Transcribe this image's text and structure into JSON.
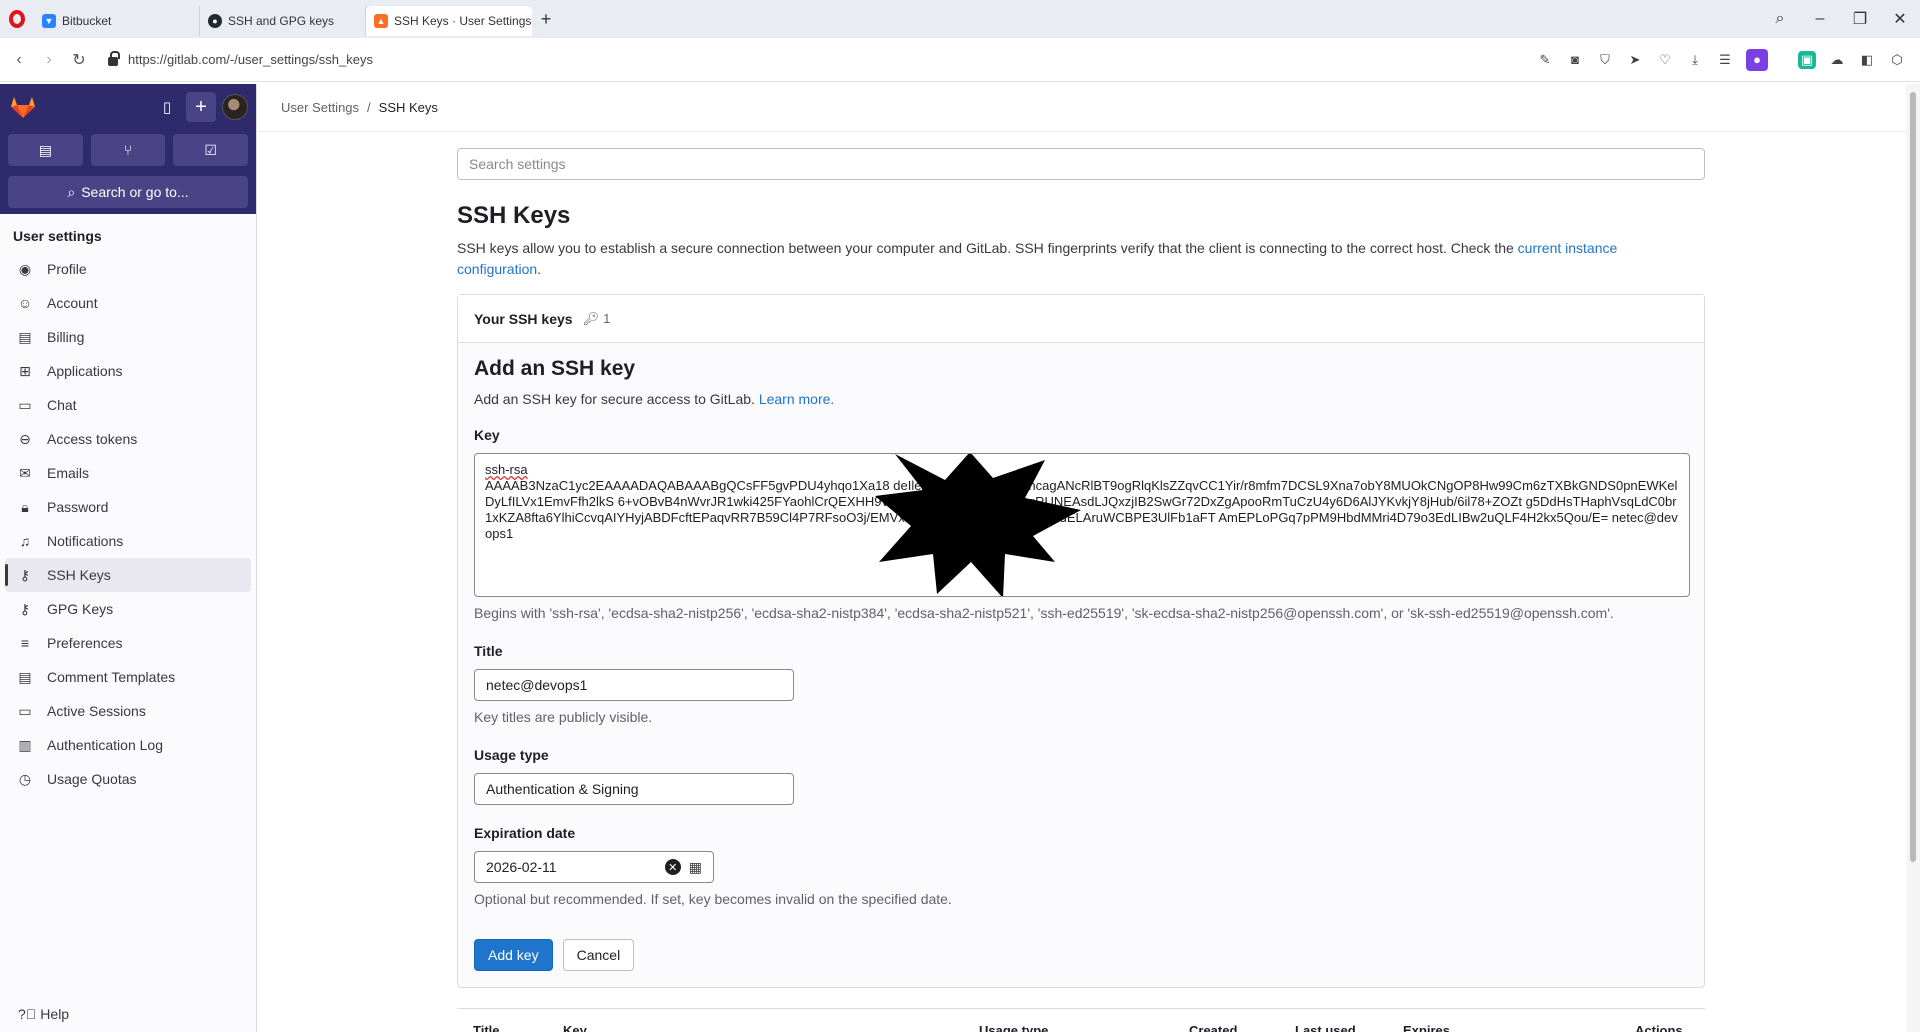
{
  "browser": {
    "tabs": [
      {
        "title": "Bitbucket",
        "color": "#2684ff"
      },
      {
        "title": "SSH and GPG keys",
        "color": "#24292f"
      },
      {
        "title": "SSH Keys · User Settings · G",
        "color": "#fc6d26"
      }
    ],
    "url": "https://gitlab.com/-/user_settings/ssh_keys"
  },
  "sidebar": {
    "search_label": "Search or go to...",
    "section_title": "User settings",
    "items": [
      {
        "label": "Profile",
        "icon": "profile-icon"
      },
      {
        "label": "Account",
        "icon": "account-icon"
      },
      {
        "label": "Billing",
        "icon": "billing-icon"
      },
      {
        "label": "Applications",
        "icon": "applications-icon"
      },
      {
        "label": "Chat",
        "icon": "chat-icon"
      },
      {
        "label": "Access tokens",
        "icon": "token-icon"
      },
      {
        "label": "Emails",
        "icon": "mail-icon"
      },
      {
        "label": "Password",
        "icon": "lock-icon"
      },
      {
        "label": "Notifications",
        "icon": "bell-icon"
      },
      {
        "label": "SSH Keys",
        "icon": "key-icon"
      },
      {
        "label": "GPG Keys",
        "icon": "key-icon"
      },
      {
        "label": "Preferences",
        "icon": "preferences-icon"
      },
      {
        "label": "Comment Templates",
        "icon": "comment-icon"
      },
      {
        "label": "Active Sessions",
        "icon": "monitor-icon"
      },
      {
        "label": "Authentication Log",
        "icon": "log-icon"
      },
      {
        "label": "Usage Quotas",
        "icon": "quota-icon"
      }
    ],
    "help_label": "Help"
  },
  "breadcrumb": {
    "parent": "User Settings",
    "separator": "/",
    "current": "SSH Keys"
  },
  "main": {
    "search_placeholder": "Search settings",
    "title": "SSH Keys",
    "intro": "SSH keys allow you to establish a secure connection between your computer and GitLab. SSH fingerprints verify that the client is connecting to the correct host. Check the ",
    "intro_link": "current instance configuration",
    "intro_end": ".",
    "card_title": "Your SSH keys",
    "key_count": "1",
    "form": {
      "heading": "Add an SSH key",
      "subtitle": "Add an SSH key for secure access to GitLab. ",
      "learn_more": "Learn more.",
      "key_label": "Key",
      "key_line1": "ssh-rsa",
      "key_value": "AAAAB3NzaC1yc2EAAAADAQABAAABgQCsFF5gvPDU4yhqo1Xa18                                              deIleXULSH18e70r/PeIhcagANcRlBT9ogRlqKlsZZqvCC1Yir/r8mfm7DCSL9Xna7obY8MUOkCNgOP8Hw99Cm6zTXBkGNDS0pnEWKelDyLfILVx1EmvFfh2lkS                                              6+vOBvB4nWvrJR1wki425FYaohlCrQEXHH9WHcitgPAtVjUNtYWPepzgRUNEAsdLJQxzjIB2SwGr72DxZgApooRmTuCzU4y6D6AlJYKvkjY8jHub/6il78+ZOZt                                              g5DdHsTHaphVsqLdC0br1xKZA8fta6YlhiCcvqAIYHyjABDFcftEPaqvRR7B59Cl4P7RFsoO3j/EMVxBpbfKXBP2qxJFbSmbbEVuELAruWCBPE3UlFb1aFT                                              AmEPLoPGq7pPM9HbdMMri4D79o3EdLIBw2uQLF4H2kx5Qou/E= netec@devops1",
      "key_help": "Begins with 'ssh-rsa', 'ecdsa-sha2-nistp256', 'ecdsa-sha2-nistp384', 'ecdsa-sha2-nistp521', 'ssh-ed25519', 'sk-ecdsa-sha2-nistp256@openssh.com', or 'sk-ssh-ed25519@openssh.com'.",
      "title_label": "Title",
      "title_value": "netec@devops1",
      "title_help": "Key titles are publicly visible.",
      "usage_label": "Usage type",
      "usage_value": "Authentication & Signing",
      "expiration_label": "Expiration date",
      "expiration_value": "2026-02-11",
      "expiration_help": "Optional but recommended. If set, key becomes invalid on the specified date.",
      "add_button": "Add key",
      "cancel_button": "Cancel"
    },
    "table_headers": [
      "Title",
      "Key",
      "Usage type",
      "Created",
      "Last used",
      "Expires",
      "Actions"
    ]
  },
  "colors": {
    "sidebar_top": "#2f2a6b",
    "primary": "#1f75cb"
  }
}
